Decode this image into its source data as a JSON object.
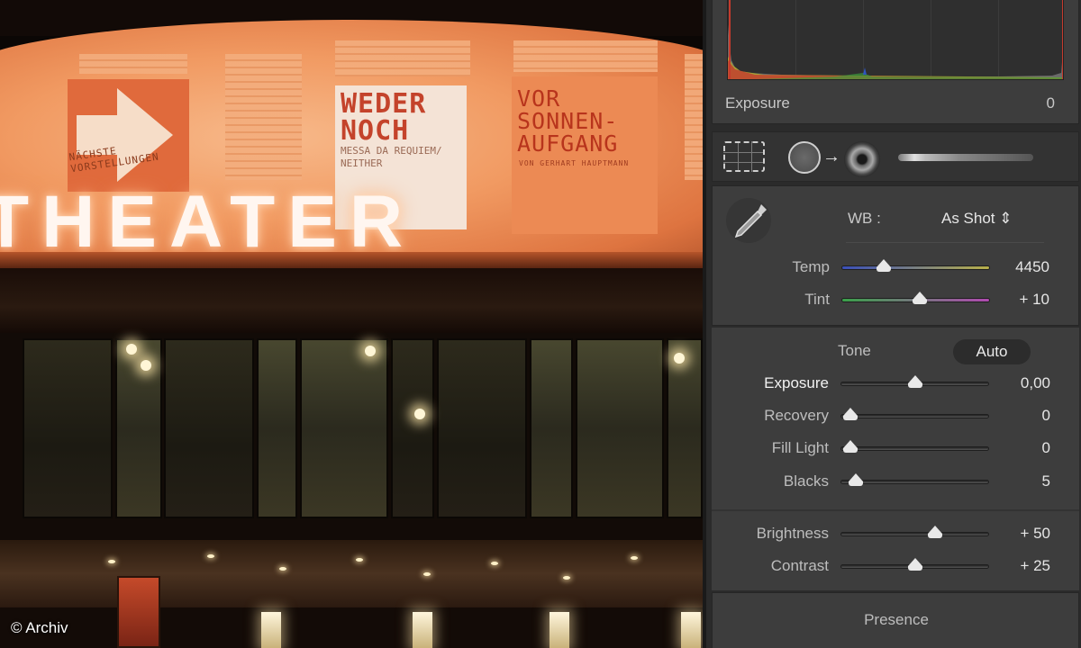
{
  "photo": {
    "facade_sign": "THEATER",
    "poster_left_text": "NÄCHSTE VORSTELLUNGEN",
    "poster_middle_title": "WEDER NOCH",
    "poster_middle_sub": "MESSA DA REQUIEM/ NEITHER",
    "poster_right_title": "VOR SONNEN- AUFGANG",
    "poster_right_sub": "VON GERHART HAUPTMANN",
    "credit": "© Archiv"
  },
  "panel": {
    "histogram": {
      "label": "Exposure",
      "value": "0"
    },
    "tools": {
      "crop": "crop-overlay-icon",
      "spot_removal": "spot-removal-icon",
      "red_eye": "red-eye-icon",
      "brush": "adjustment-brush-icon"
    },
    "white_balance": {
      "label": "WB :",
      "value": "As Shot ⇕",
      "temp": {
        "label": "Temp",
        "value": "4450",
        "position": 0.28
      },
      "tint": {
        "label": "Tint",
        "value": "+ 10",
        "position": 0.53
      }
    },
    "tone": {
      "label": "Tone",
      "auto_label": "Auto",
      "exposure": {
        "label": "Exposure",
        "value": "0,00",
        "position": 0.5
      },
      "recovery": {
        "label": "Recovery",
        "value": "0",
        "position": 0.06
      },
      "fill_light": {
        "label": "Fill Light",
        "value": "0",
        "position": 0.06
      },
      "blacks": {
        "label": "Blacks",
        "value": "5",
        "position": 0.1
      },
      "brightness": {
        "label": "Brightness",
        "value": "+ 50",
        "position": 0.64
      },
      "contrast": {
        "label": "Contrast",
        "value": "+ 25",
        "position": 0.5
      }
    },
    "presence": {
      "label": "Presence"
    }
  },
  "colors": {
    "panel_bg": "#3d3d3d",
    "slider_thumb": "#e8e8e8",
    "facade_glow": "#f19a62"
  }
}
